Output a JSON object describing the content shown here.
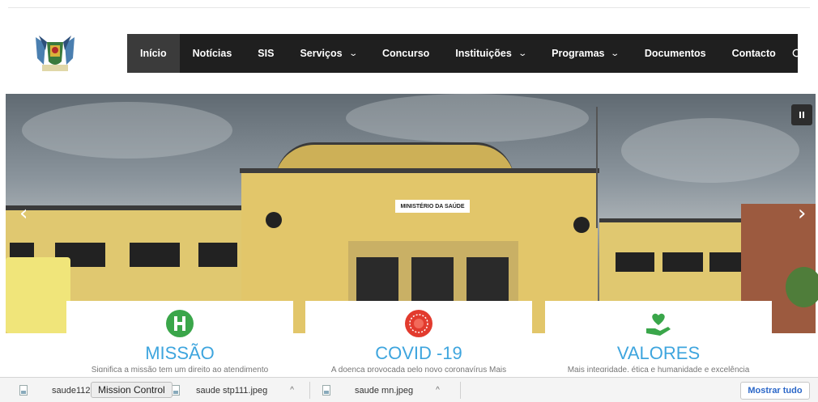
{
  "header": {
    "logo_name": "coat-of-arms-logo"
  },
  "nav": {
    "items": [
      {
        "label": "Início",
        "active": true,
        "dropdown": false
      },
      {
        "label": "Notícias",
        "dropdown": false
      },
      {
        "label": "SIS",
        "dropdown": false
      },
      {
        "label": "Serviços",
        "dropdown": true
      },
      {
        "label": "Concurso",
        "dropdown": false
      },
      {
        "label": "Instituições",
        "dropdown": true
      },
      {
        "label": "Programas",
        "dropdown": true
      },
      {
        "label": "Documentos",
        "dropdown": false
      },
      {
        "label": "Contacto",
        "dropdown": false
      }
    ],
    "search_icon": "search-icon",
    "bg_color": "#1f1f1f",
    "active_color": "#3b3b3b"
  },
  "slider": {
    "sign_text": "MINISTÉRIO DA SAÚDE",
    "prev_glyph": "‹",
    "next_glyph": "›"
  },
  "cards": [
    {
      "title": "MISSÃO",
      "icon": "hospital-h-icon",
      "icon_color": "#3aa64a",
      "text": "Significa a missão tem um direito ao atendimento"
    },
    {
      "title": "COVID -19",
      "icon": "virus-icon",
      "icon_color": "#e23b2e",
      "text": "A doença provocada pelo novo coronavírus Mais"
    },
    {
      "title": "VALORES",
      "icon": "heart-hand-icon",
      "icon_color": "#3aa64a",
      "text": "Mais integridade, ética e humanidade e excelência"
    }
  ],
  "accent_color": "#3ea5de",
  "downloads": {
    "items": [
      {
        "name": "saude112"
      },
      {
        "name": "saude stp111.jpeg"
      },
      {
        "name": "saude mn.jpeg"
      }
    ],
    "caret": "^",
    "tooltip": "Mission Control",
    "show_all": "Mostrar tudo"
  }
}
